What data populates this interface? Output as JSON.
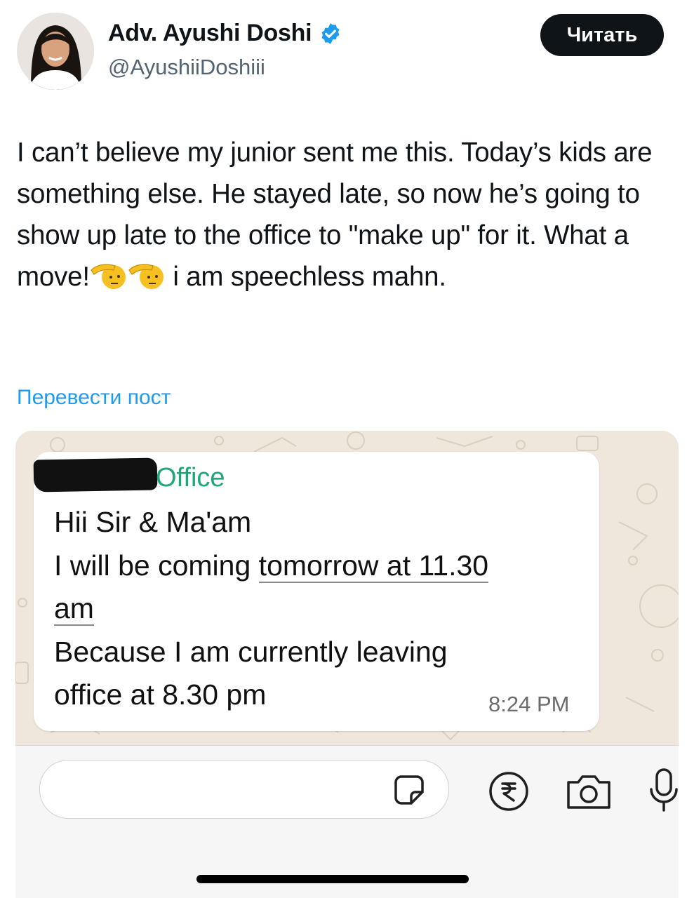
{
  "author": {
    "name": "Adv. Ayushi Doshi",
    "handle": "@AyushiiDoshiii",
    "verified_icon": "verified-badge-icon"
  },
  "follow_button": "Читать",
  "post": {
    "text_part1": "I can’t believe my junior sent me this. Today’s kids are something else. He stayed late, so now he’s going to show up late to the office to \"make up\" for it. What a move!",
    "text_part2": " i am speechless mahn.",
    "emoji": "saluting-face-emoji"
  },
  "translate_link": "Перевести пост",
  "screenshot": {
    "sender": "Office",
    "message_lines": [
      "Hii Sir & Ma'am",
      "I will be coming ",
      "tomorrow at 11.30",
      "am",
      "Because I am currently leaving",
      "office at 8.30 pm"
    ],
    "time": "8:24 PM",
    "icons": [
      "sticker-icon",
      "rupee-icon",
      "camera-icon",
      "microphone-icon"
    ]
  },
  "colors": {
    "accent_link": "#1d9bf0",
    "verified": "#1d9bf0",
    "whatsapp_sender": "#1fa67a"
  }
}
